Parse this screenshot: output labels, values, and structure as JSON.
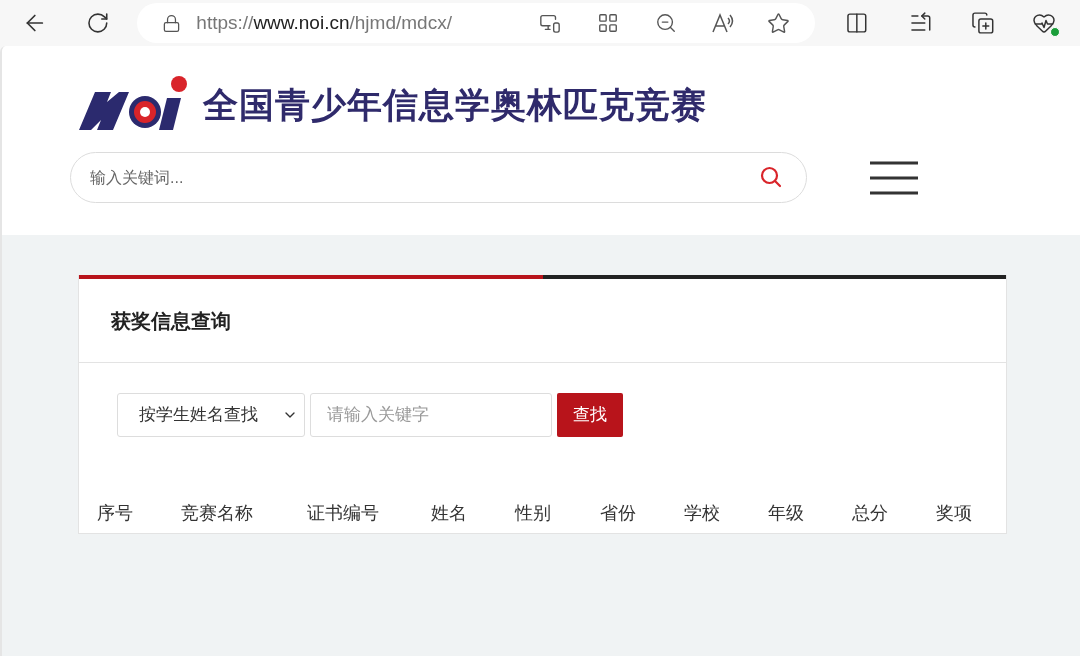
{
  "browser": {
    "url": {
      "scheme": "https://",
      "host": "www.noi.cn",
      "path": "/hjmd/mdcx/"
    }
  },
  "header": {
    "site_title": "全国青少年信息学奥林匹克竞赛",
    "search": {
      "placeholder": "输入关键词..."
    }
  },
  "panel": {
    "title": "获奖信息查询",
    "filter": {
      "mode": "按学生姓名查找",
      "keyword_placeholder": "请输入关键字",
      "submit": "查找"
    },
    "table": {
      "columns": [
        "序号",
        "竞赛名称",
        "证书编号",
        "姓名",
        "性别",
        "省份",
        "学校",
        "年级",
        "总分",
        "奖项"
      ]
    }
  }
}
